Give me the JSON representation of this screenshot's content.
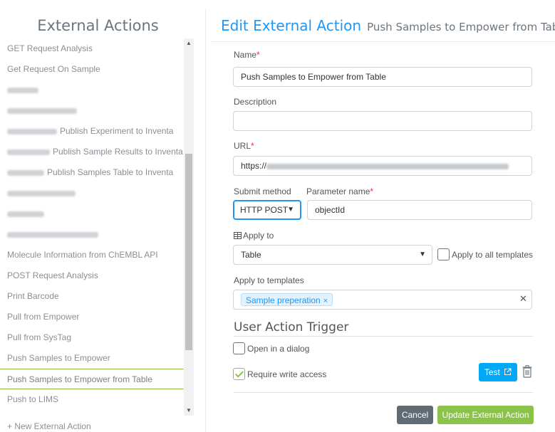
{
  "sidebar": {
    "title": "External Actions",
    "items": [
      {
        "label": "GET Request Analysis"
      },
      {
        "label": "Get Request On Sample"
      },
      {
        "label": ""
      },
      {
        "label": ""
      },
      {
        "label": "Publish Experiment to Inventa"
      },
      {
        "label": "Publish Sample Results to Inventa"
      },
      {
        "label": "Publish Samples Table to Inventa"
      },
      {
        "label": ""
      },
      {
        "label": ""
      },
      {
        "label": ""
      },
      {
        "label": "Molecule Information from ChEMBL API"
      },
      {
        "label": "POST Request Analysis"
      },
      {
        "label": "Print Barcode"
      },
      {
        "label": "Pull from Empower"
      },
      {
        "label": "Pull from SysTag"
      },
      {
        "label": "Push Samples to Empower"
      },
      {
        "label": "Push Samples to Empower from Table"
      },
      {
        "label": "Push to LIMS"
      }
    ],
    "new_action": "+ New External Action"
  },
  "header": {
    "title": "Edit External Action",
    "subtitle": "Push Samples to Empower from Table"
  },
  "form": {
    "name_label": "Name",
    "name_value": "Push Samples to Empower from Table",
    "description_label": "Description",
    "description_value": "",
    "url_label": "URL",
    "url_value": "https://",
    "submit_method_label": "Submit method",
    "submit_method_value": "HTTP POST",
    "parameter_name_label": "Parameter name",
    "parameter_name_value": "objectId",
    "apply_to_label": "Apply to",
    "apply_to_value": "Table",
    "apply_all_label": "Apply to all templates",
    "apply_templates_label": "Apply to templates",
    "template_tag": "Sample preperation",
    "trigger_title": "User Action Trigger",
    "open_dialog_label": "Open in a dialog",
    "write_access_label": "Require write access",
    "test_label": "Test",
    "cancel_label": "Cancel",
    "update_label": "Update External Action"
  },
  "colors": {
    "accent": "#2196f3",
    "success": "#8bc34a",
    "info": "#03a9f4",
    "secondary": "#5f6b75"
  },
  "state": {
    "apply_all_checked": false,
    "open_dialog_checked": false,
    "write_access_checked": true
  }
}
